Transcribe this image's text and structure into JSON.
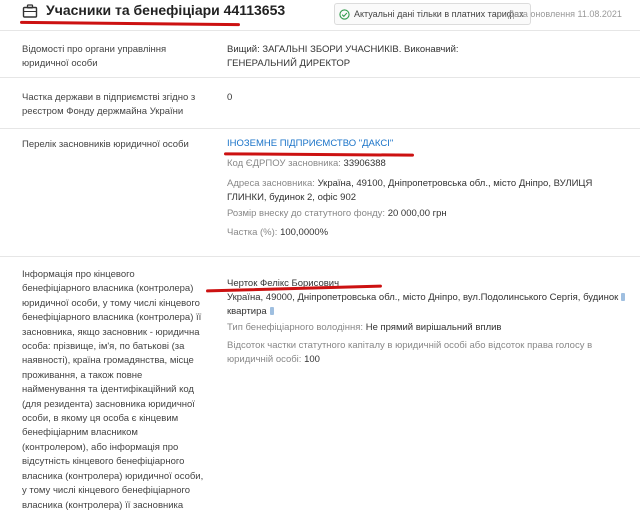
{
  "header": {
    "title": "Учасники та бенефіціари 44113653",
    "badge_text": "Актуальні дані тільки в платних тарифах",
    "update_date": "Дата оновлення 11.08.2021",
    "icons": {
      "title": "briefcase-icon",
      "badge": "check-circle-icon"
    },
    "underline_color": "#cc1111"
  },
  "rows": {
    "management": {
      "label": "Відомості про органи управління юридичної особи",
      "value": "Вищий: ЗАГАЛЬНІ ЗБОРИ УЧАСНИКІВ. Виконавчий: ГЕНЕРАЛЬНИЙ ДИРЕКТОР"
    },
    "state_share": {
      "label": "Частка держави в підприємстві згідно з реєстром Фонду держмайна України",
      "value": "0"
    },
    "founders": {
      "label": "Перелік засновників юридичної особи",
      "name": "ІНОЗЕМНЕ ПІДПРИЄМСТВО \"ДАКСІ\"",
      "edrpou_label": "Код ЄДРПОУ засновника:",
      "edrpou_value": "33906388",
      "address_label": "Адреса засновника:",
      "address_value": "Україна, 49100, Дніпропетровська обл., місто Дніпро, ВУЛИЦЯ ГЛИНКИ, будинок 2, офіс 902",
      "capital_label": "Розмір внеску до статутного фонду:",
      "capital_value": "20 000,00 грн",
      "share_label": "Частка (%):",
      "share_value": "100,0000%"
    },
    "beneficiary": {
      "label": "Інформація про кінцевого бенефіціарного власника (контролера) юридичної особи, у тому числі кінцевого бенефіціарного власника (контролера) її засновника, якщо засновник - юридична особа: прізвище, ім'я, по батькові (за наявності), країна громадянства, місце проживання, а також повне найменування та ідентифікаційний код (для резидента) засновника юридичної особи, в якому ця особа є кінцевим бенефіціарним власником (контролером), або інформація про відсутність кінцевого бенефіціарного власника (контролера) юридичної особи, у тому числі кінцевого бенефіціарного власника (контролера) її засновника",
      "name": "Черток Фелікс Борисович",
      "address_line1": "Україна, 49000, Дніпропетровська обл., місто Дніпро, вул.Подолинського Сергія, будинок",
      "address_line2": "квартира",
      "ownership_label": "Тип бенефіціарного володіння:",
      "ownership_value": "Не прямий вирішальний вплив",
      "percent_label": "Відсоток частки статутного капіталу в юридичній особі або відсоток права голосу в юридичній особі:",
      "percent_value": "100"
    }
  }
}
